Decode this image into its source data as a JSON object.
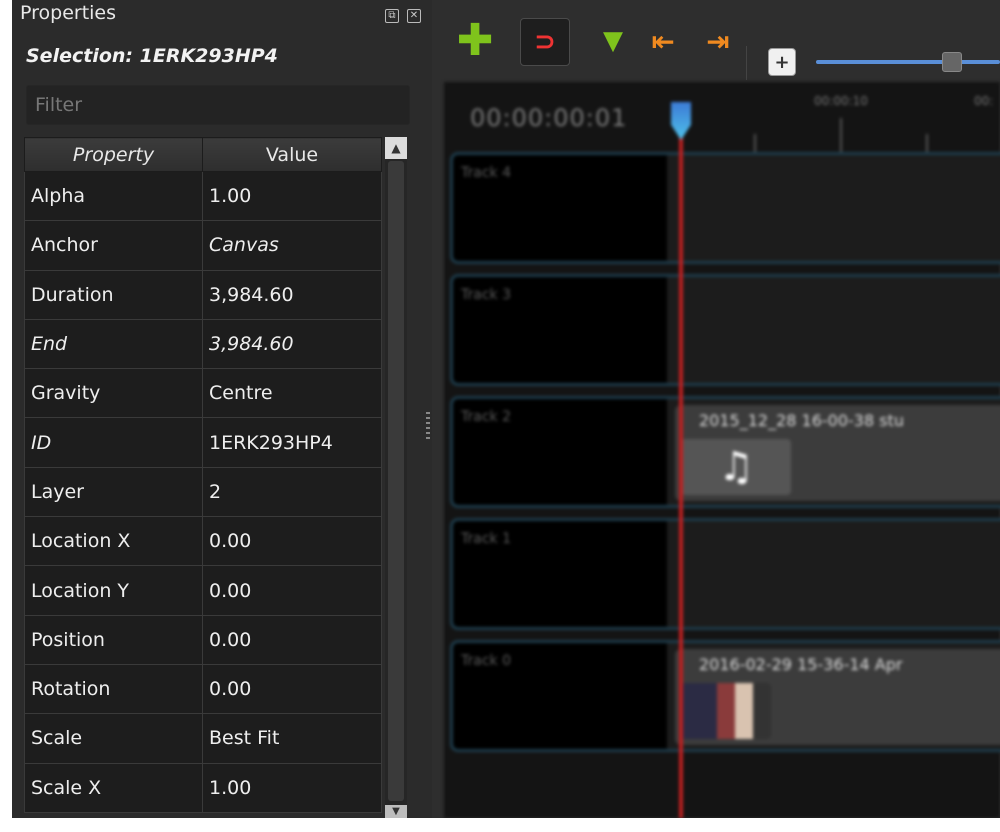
{
  "properties": {
    "title": "Properties",
    "selection": "Selection: 1ERK293HP4",
    "filter_placeholder": "Filter",
    "columns": {
      "property": "Property",
      "value": "Value"
    },
    "rows": [
      {
        "key": "Alpha",
        "value": "1.00"
      },
      {
        "key": "Anchor",
        "value": "Canvas"
      },
      {
        "key": "Duration",
        "value": "3,984.60"
      },
      {
        "key": "End",
        "value": "3,984.60"
      },
      {
        "key": "Gravity",
        "value": "Centre"
      },
      {
        "key": "ID",
        "value": "1ERK293HP4"
      },
      {
        "key": "Layer",
        "value": "2"
      },
      {
        "key": "Location X",
        "value": "0.00"
      },
      {
        "key": "Location Y",
        "value": "0.00"
      },
      {
        "key": "Position",
        "value": "0.00"
      },
      {
        "key": "Rotation",
        "value": "0.00"
      },
      {
        "key": "Scale",
        "value": "Best Fit"
      },
      {
        "key": "Scale X",
        "value": "1.00"
      }
    ]
  },
  "timeline": {
    "timecode": "00:00:00:01",
    "ruler_labels": [
      "00:00:10",
      "00:"
    ],
    "tracks": [
      {
        "name": "Track 4",
        "clip": ""
      },
      {
        "name": "Track 3",
        "clip": ""
      },
      {
        "name": "Track 2",
        "clip": "2015_12_28 16-00-38 stu"
      },
      {
        "name": "Track 1",
        "clip": ""
      },
      {
        "name": "Track 0",
        "clip": "2016-02-29 15-36-14 Apr"
      }
    ],
    "icons": {
      "add": "plus-icon",
      "snap": "magnet-icon",
      "marker": "marker-icon",
      "prev": "jump-start-icon",
      "next": "jump-end-icon",
      "zoom": "zoom-in-icon"
    },
    "colors": {
      "add": "#7fc31c",
      "snap": "#ee3333",
      "jump": "#f08a20",
      "playhead": "#c02020",
      "accent": "#5a8fd8"
    }
  }
}
